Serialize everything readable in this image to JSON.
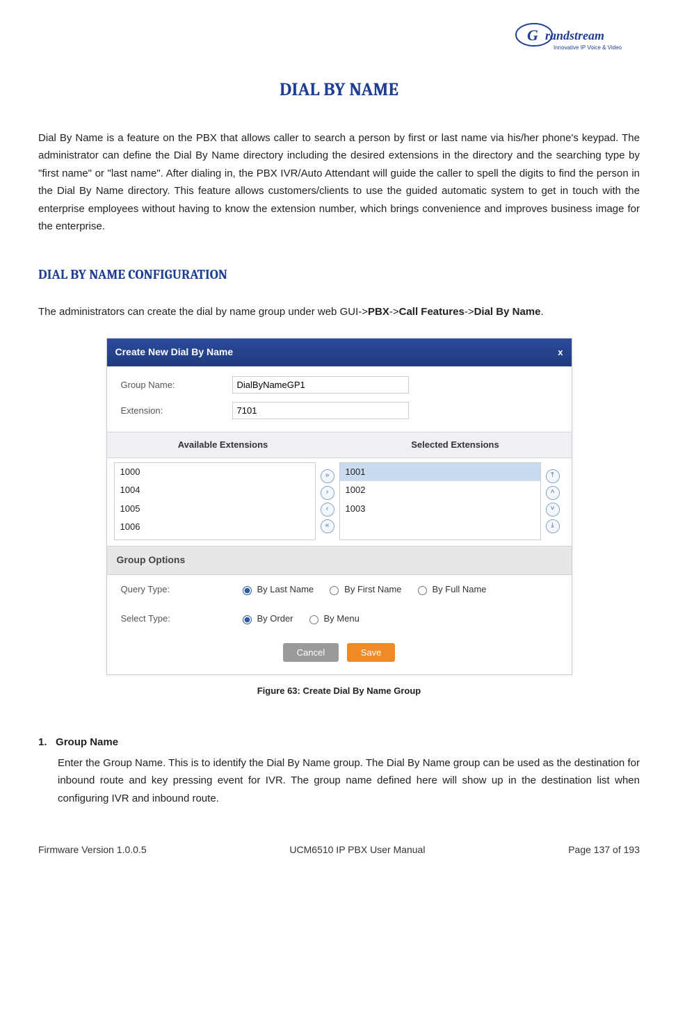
{
  "brand": {
    "name": "Grandstream",
    "tagline": "Innovative IP Voice & Video"
  },
  "title": "DIAL BY NAME",
  "intro": "Dial By Name is a feature on the PBX that allows caller to search a person by first or last name via his/her phone's keypad. The administrator can define the Dial By Name directory including the desired extensions in the directory and the searching type by \"first name\" or \"last name\". After dialing in, the PBX IVR/Auto Attendant will guide the caller to spell the digits to find the person in the Dial By Name directory. This feature allows customers/clients to use the guided automatic system to get in touch with the enterprise employees without having to know the extension number, which brings convenience and improves business image for the enterprise.",
  "section2_title": "DIAL BY NAME CONFIGURATION",
  "config_text_pre": "The administrators can create the dial by name group under web GUI->",
  "config_text_b1": "PBX",
  "config_text_s1": "->",
  "config_text_b2": "Call Features",
  "config_text_s2": "->",
  "config_text_b3": "Dial By Name",
  "config_text_post": ".",
  "dialog": {
    "title": "Create New Dial By Name",
    "close": "x",
    "group_name_label": "Group Name:",
    "group_name_value": "DialByNameGP1",
    "extension_label": "Extension:",
    "extension_value": "7101",
    "avail_hdr": "Available Extensions",
    "sel_hdr": "Selected Extensions",
    "available": [
      "1000",
      "1004",
      "1005",
      "1006"
    ],
    "selected": [
      "1001",
      "1002",
      "1003"
    ],
    "group_options_hdr": "Group Options",
    "query_label": "Query Type:",
    "query_opts": [
      "By Last Name",
      "By First Name",
      "By Full Name"
    ],
    "select_label": "Select Type:",
    "select_opts": [
      "By Order",
      "By Menu"
    ],
    "cancel": "Cancel",
    "save": "Save"
  },
  "fig_caption": "Figure 63: Create Dial By Name Group",
  "step1_num": "1.",
  "step1_title": "Group Name",
  "step1_body": "Enter the Group Name. This is to identify the Dial By Name group. The Dial By Name group can be used as the destination for inbound route and key pressing event for IVR. The group name defined here will show up in the destination list when configuring IVR and inbound route.",
  "footer": {
    "left": "Firmware Version 1.0.0.5",
    "center": "UCM6510 IP PBX User Manual",
    "right": "Page 137 of 193"
  }
}
